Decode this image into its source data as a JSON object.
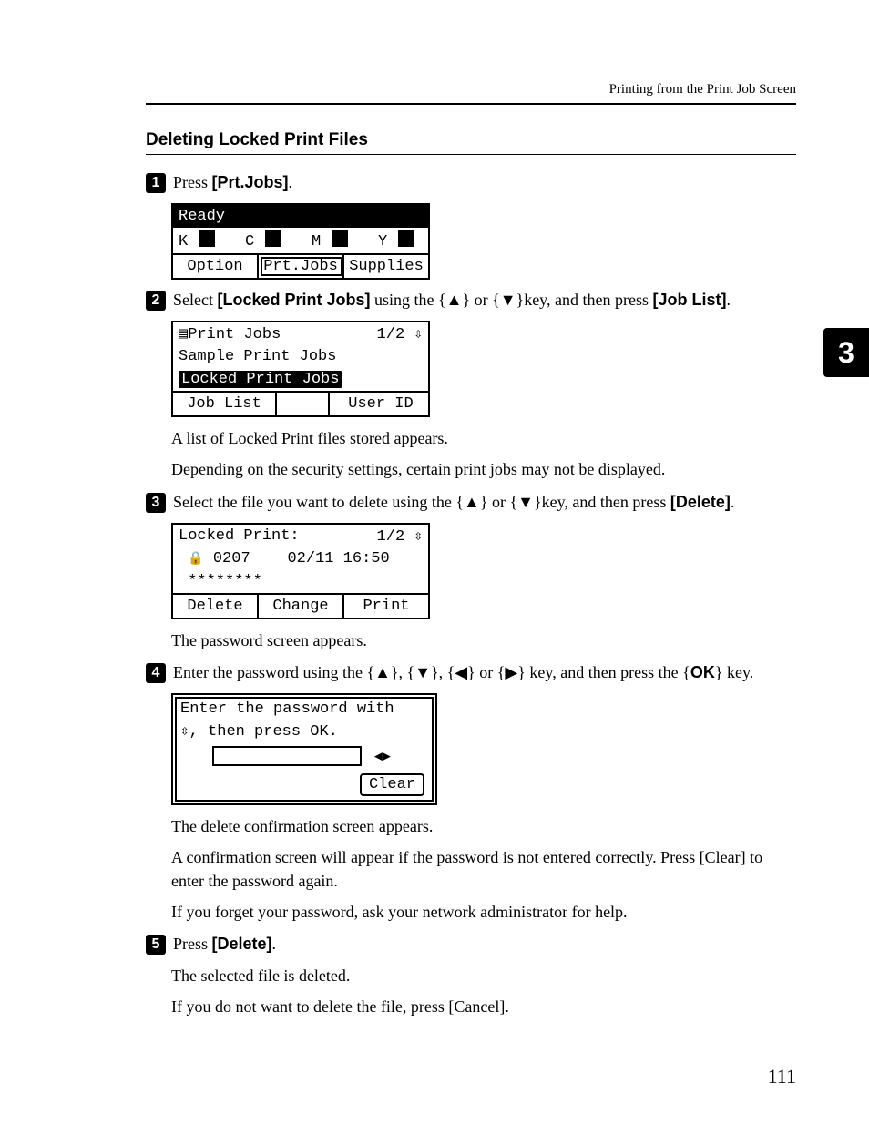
{
  "running_head": "Printing from the Print Job Screen",
  "chapter_tab": "3",
  "section_title": "Deleting Locked Print Files",
  "page_number": "111",
  "steps": {
    "s1": {
      "num": "1",
      "pre": "Press ",
      "bold": "[Prt.Jobs]",
      "post": "."
    },
    "s2": {
      "num": "2",
      "pre": "Select ",
      "bold1": "[Locked Print Jobs]",
      "mid": " using the {▲} or {▼}key, and then press ",
      "bold2": "[Job List]",
      "post": "."
    },
    "s3": {
      "num": "3",
      "pre": "Select the file you want to delete using the {▲} or {▼}key, and then press ",
      "bold": "[Delete]",
      "post": "."
    },
    "s4": {
      "num": "4",
      "pre": "Enter the password using the {▲}, {▼}, {◀} or {▶} key, and then press the {",
      "bold": "OK",
      "post": "} key."
    },
    "s5": {
      "num": "5",
      "pre": "Press ",
      "bold": "[Delete]",
      "post": "."
    }
  },
  "body": {
    "after2a": "A list of Locked Print files stored appears.",
    "after2b": "Depending on the security settings, certain print jobs may not be displayed.",
    "after3": "The password screen appears.",
    "after4a": "The delete confirmation screen appears.",
    "after4b_pre": "A confirmation screen will appear if the password is not entered correctly. Press ",
    "after4b_bold": "[Clear]",
    "after4b_post": " to enter the password again.",
    "after4c": "If you forget your password, ask your network administrator for help.",
    "after5a": "The selected file is deleted.",
    "after5b_pre": "If you do not want to delete the file, press ",
    "after5b_bold": "[Cancel]",
    "after5b_post": "."
  },
  "lcd1": {
    "status": "Ready",
    "toners": [
      "K",
      "C",
      "M",
      "Y"
    ],
    "soft": [
      "Option",
      "Prt.Jobs",
      "Supplies"
    ]
  },
  "lcd2": {
    "title": "Print Jobs",
    "page": "1/2",
    "items": [
      "Sample Print Jobs",
      "Locked Print Jobs"
    ],
    "soft_left": "Job List",
    "soft_right": "User ID"
  },
  "lcd3": {
    "title": "Locked Print:",
    "page": "1/2",
    "file_id": "0207",
    "file_ts": "02/11 16:50",
    "mask": "********",
    "soft": [
      "Delete",
      "Change",
      "Print"
    ]
  },
  "lcd4": {
    "line1": "Enter the password with",
    "line2": ", then press OK.",
    "clear": "Clear"
  }
}
